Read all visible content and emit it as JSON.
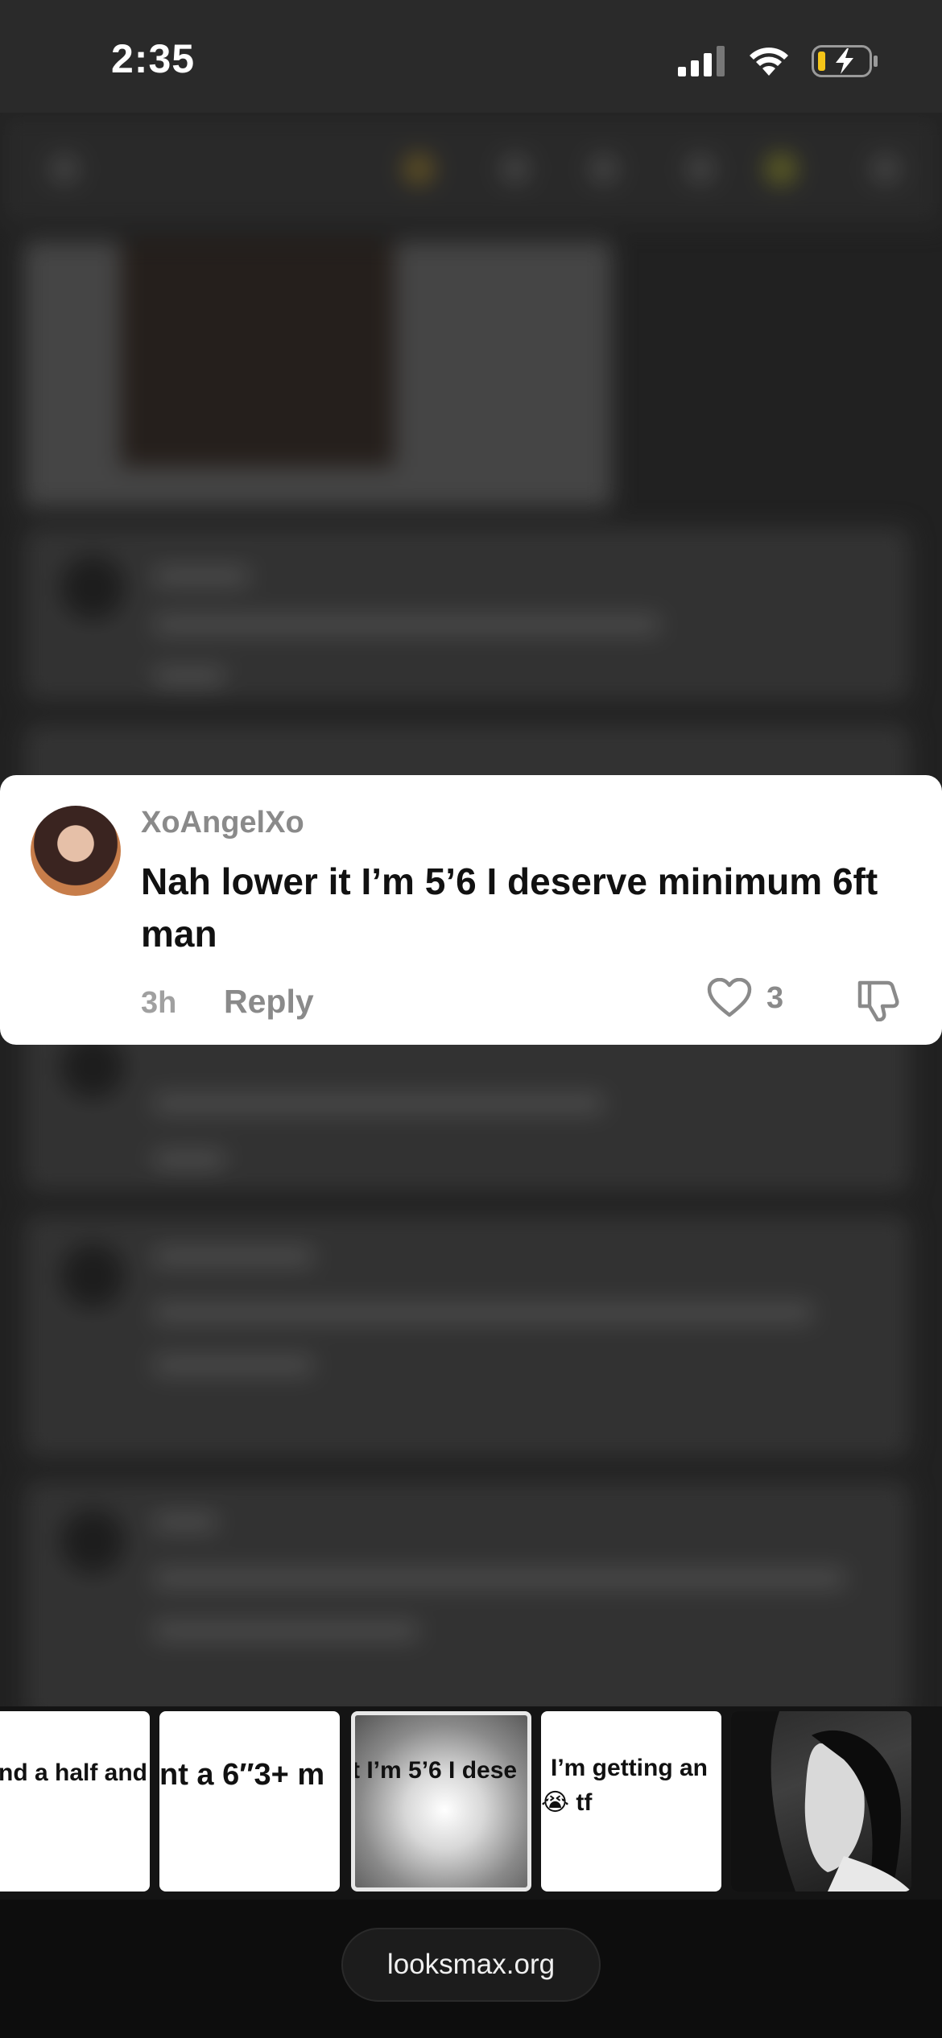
{
  "status_bar": {
    "time": "2:35",
    "icons": [
      "signal-icon",
      "wifi-icon",
      "battery-charging-icon"
    ]
  },
  "comment": {
    "username": "XoAngelXo",
    "text": "Nah lower it I’m 5’6 I deserve minimum 6ft man",
    "time": "3h",
    "reply_label": "Reply",
    "like_count": "3"
  },
  "thumbnails": [
    {
      "text": "nd a half and"
    },
    {
      "text": "nt a 6″3+ m"
    },
    {
      "text": "t I’m 5’6 I dese"
    },
    {
      "text": "I’m getting an",
      "text2": "tf",
      "emoji": "😭"
    },
    {
      "text": ""
    }
  ],
  "url_bar": {
    "url": "looksmax.org"
  },
  "colors": {
    "card_bg": "#ffffff",
    "muted": "#8a8a8a",
    "accent_battery": "#f5c518"
  }
}
